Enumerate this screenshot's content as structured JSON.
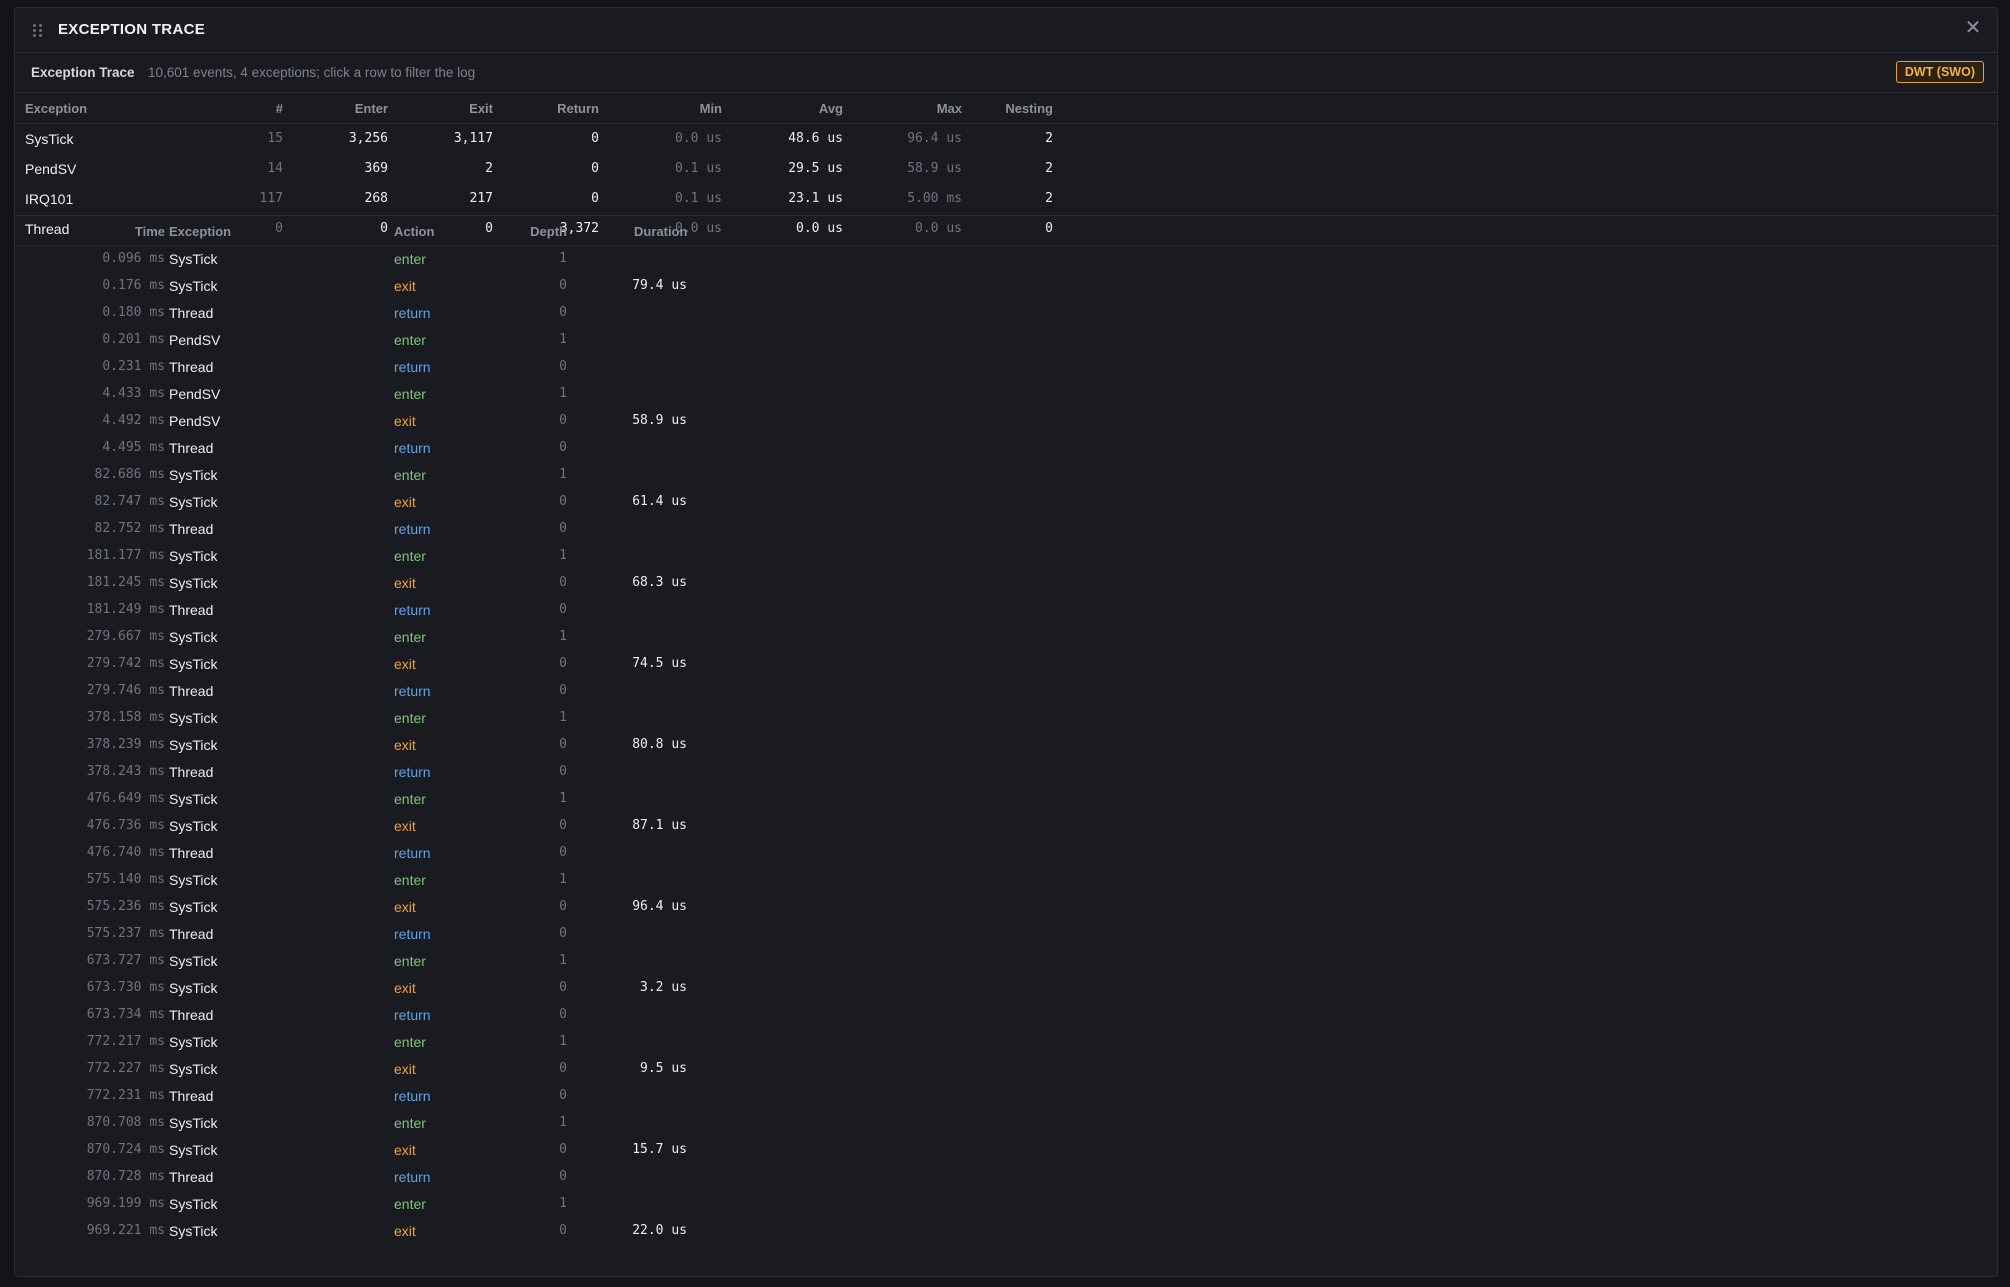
{
  "window": {
    "title": "EXCEPTION TRACE",
    "close_glyph": "✕"
  },
  "subheader": {
    "title": "Exception Trace",
    "description": "10,601 events, 4 exceptions; click a row to filter the log",
    "badge": "DWT (SWO)"
  },
  "summary": {
    "columns": [
      "Exception",
      "#",
      "Enter",
      "Exit",
      "Return",
      "Min",
      "Avg",
      "Max",
      "Nesting"
    ],
    "rows": [
      {
        "exception": "SysTick",
        "num": "15",
        "enter": "3,256",
        "exit": "3,117",
        "return": "0",
        "min": "0.0 us",
        "avg": "48.6 us",
        "max": "96.4 us",
        "nesting": "2"
      },
      {
        "exception": "PendSV",
        "num": "14",
        "enter": "369",
        "exit": "2",
        "return": "0",
        "min": "0.1 us",
        "avg": "29.5 us",
        "max": "58.9 us",
        "nesting": "2"
      },
      {
        "exception": "IRQ101",
        "num": "117",
        "enter": "268",
        "exit": "217",
        "return": "0",
        "min": "0.1 us",
        "avg": "23.1 us",
        "max": "5.00 ms",
        "nesting": "2"
      },
      {
        "exception": "Thread",
        "num": "0",
        "enter": "0",
        "exit": "0",
        "return": "3,372",
        "min": "0.0 us",
        "avg": "0.0 us",
        "max": "0.0 us",
        "nesting": "0"
      }
    ]
  },
  "log": {
    "columns": [
      "Time",
      "Exception",
      "Action",
      "Depth",
      "Duration"
    ],
    "rows": [
      {
        "time": "0.096 ms",
        "exception": "SysTick",
        "action": "enter",
        "depth": "1",
        "duration": ""
      },
      {
        "time": "0.176 ms",
        "exception": "SysTick",
        "action": "exit",
        "depth": "0",
        "duration": "79.4 us"
      },
      {
        "time": "0.180 ms",
        "exception": "Thread",
        "action": "return",
        "depth": "0",
        "duration": ""
      },
      {
        "time": "0.201 ms",
        "exception": "PendSV",
        "action": "enter",
        "depth": "1",
        "duration": ""
      },
      {
        "time": "0.231 ms",
        "exception": "Thread",
        "action": "return",
        "depth": "0",
        "duration": ""
      },
      {
        "time": "4.433 ms",
        "exception": "PendSV",
        "action": "enter",
        "depth": "1",
        "duration": ""
      },
      {
        "time": "4.492 ms",
        "exception": "PendSV",
        "action": "exit",
        "depth": "0",
        "duration": "58.9 us"
      },
      {
        "time": "4.495 ms",
        "exception": "Thread",
        "action": "return",
        "depth": "0",
        "duration": ""
      },
      {
        "time": "82.686 ms",
        "exception": "SysTick",
        "action": "enter",
        "depth": "1",
        "duration": ""
      },
      {
        "time": "82.747 ms",
        "exception": "SysTick",
        "action": "exit",
        "depth": "0",
        "duration": "61.4 us"
      },
      {
        "time": "82.752 ms",
        "exception": "Thread",
        "action": "return",
        "depth": "0",
        "duration": ""
      },
      {
        "time": "181.177 ms",
        "exception": "SysTick",
        "action": "enter",
        "depth": "1",
        "duration": ""
      },
      {
        "time": "181.245 ms",
        "exception": "SysTick",
        "action": "exit",
        "depth": "0",
        "duration": "68.3 us"
      },
      {
        "time": "181.249 ms",
        "exception": "Thread",
        "action": "return",
        "depth": "0",
        "duration": ""
      },
      {
        "time": "279.667 ms",
        "exception": "SysTick",
        "action": "enter",
        "depth": "1",
        "duration": ""
      },
      {
        "time": "279.742 ms",
        "exception": "SysTick",
        "action": "exit",
        "depth": "0",
        "duration": "74.5 us"
      },
      {
        "time": "279.746 ms",
        "exception": "Thread",
        "action": "return",
        "depth": "0",
        "duration": ""
      },
      {
        "time": "378.158 ms",
        "exception": "SysTick",
        "action": "enter",
        "depth": "1",
        "duration": ""
      },
      {
        "time": "378.239 ms",
        "exception": "SysTick",
        "action": "exit",
        "depth": "0",
        "duration": "80.8 us"
      },
      {
        "time": "378.243 ms",
        "exception": "Thread",
        "action": "return",
        "depth": "0",
        "duration": ""
      },
      {
        "time": "476.649 ms",
        "exception": "SysTick",
        "action": "enter",
        "depth": "1",
        "duration": ""
      },
      {
        "time": "476.736 ms",
        "exception": "SysTick",
        "action": "exit",
        "depth": "0",
        "duration": "87.1 us"
      },
      {
        "time": "476.740 ms",
        "exception": "Thread",
        "action": "return",
        "depth": "0",
        "duration": ""
      },
      {
        "time": "575.140 ms",
        "exception": "SysTick",
        "action": "enter",
        "depth": "1",
        "duration": ""
      },
      {
        "time": "575.236 ms",
        "exception": "SysTick",
        "action": "exit",
        "depth": "0",
        "duration": "96.4 us"
      },
      {
        "time": "575.237 ms",
        "exception": "Thread",
        "action": "return",
        "depth": "0",
        "duration": ""
      },
      {
        "time": "673.727 ms",
        "exception": "SysTick",
        "action": "enter",
        "depth": "1",
        "duration": ""
      },
      {
        "time": "673.730 ms",
        "exception": "SysTick",
        "action": "exit",
        "depth": "0",
        "duration": "3.2 us"
      },
      {
        "time": "673.734 ms",
        "exception": "Thread",
        "action": "return",
        "depth": "0",
        "duration": ""
      },
      {
        "time": "772.217 ms",
        "exception": "SysTick",
        "action": "enter",
        "depth": "1",
        "duration": ""
      },
      {
        "time": "772.227 ms",
        "exception": "SysTick",
        "action": "exit",
        "depth": "0",
        "duration": "9.5 us"
      },
      {
        "time": "772.231 ms",
        "exception": "Thread",
        "action": "return",
        "depth": "0",
        "duration": ""
      },
      {
        "time": "870.708 ms",
        "exception": "SysTick",
        "action": "enter",
        "depth": "1",
        "duration": ""
      },
      {
        "time": "870.724 ms",
        "exception": "SysTick",
        "action": "exit",
        "depth": "0",
        "duration": "15.7 us"
      },
      {
        "time": "870.728 ms",
        "exception": "Thread",
        "action": "return",
        "depth": "0",
        "duration": ""
      },
      {
        "time": "969.199 ms",
        "exception": "SysTick",
        "action": "enter",
        "depth": "1",
        "duration": ""
      },
      {
        "time": "969.221 ms",
        "exception": "SysTick",
        "action": "exit",
        "depth": "0",
        "duration": "22.0 us"
      }
    ]
  },
  "colors": {
    "enter": "#7ec47a",
    "exit": "#f0a23a",
    "return": "#5ea3e8",
    "badge": "#f0b34a"
  },
  "icons": {
    "drag_handle": "grip-vertical-icon",
    "close": "close-icon"
  }
}
